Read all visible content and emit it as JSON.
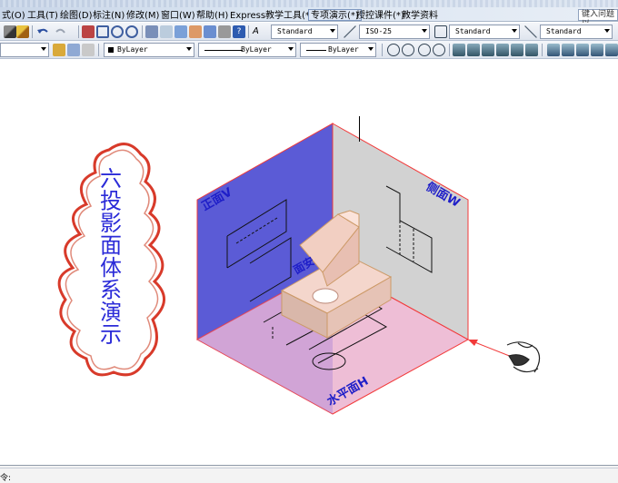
{
  "menu": [
    {
      "label": "式(O)"
    },
    {
      "label": "工具(T)"
    },
    {
      "label": "绘图(D)"
    },
    {
      "label": "标注(N)"
    },
    {
      "label": "修改(M)"
    },
    {
      "label": "窗口(W)"
    },
    {
      "label": "帮助(H)"
    },
    {
      "label": "Express"
    },
    {
      "label": "教学工具(*)"
    },
    {
      "label": "专项演示(*)"
    },
    {
      "label": "授控课件(*)"
    },
    {
      "label": "教学资料"
    }
  ],
  "help_search": {
    "placeholder": "键入问题以"
  },
  "toolbar1": {
    "text_style": "Standard",
    "dim_style": "ISO-25",
    "table_style": "Standard",
    "multileader_style": "Standard"
  },
  "toolbar2": {
    "layer_color": "ByLayer",
    "linetype": "ByLayer",
    "lineweight": "ByLayer"
  },
  "drawing": {
    "title_chars": [
      "六",
      "投",
      "影",
      "面",
      "体",
      "系",
      "演",
      "示"
    ],
    "plane_front": "正面V",
    "plane_side": "侧面W",
    "plane_horizontal": "水平面H",
    "plane_label_small": "面安",
    "colors": {
      "front_plane": "#5b5bd6",
      "side_plane": "#d2d2d2",
      "bottom_plane": "#e8a8c8",
      "edge": "#f23a3a",
      "title_text": "#2b2bd8",
      "cloud_outline": "#d83a2a"
    }
  },
  "command": {
    "prompt": "令:"
  }
}
